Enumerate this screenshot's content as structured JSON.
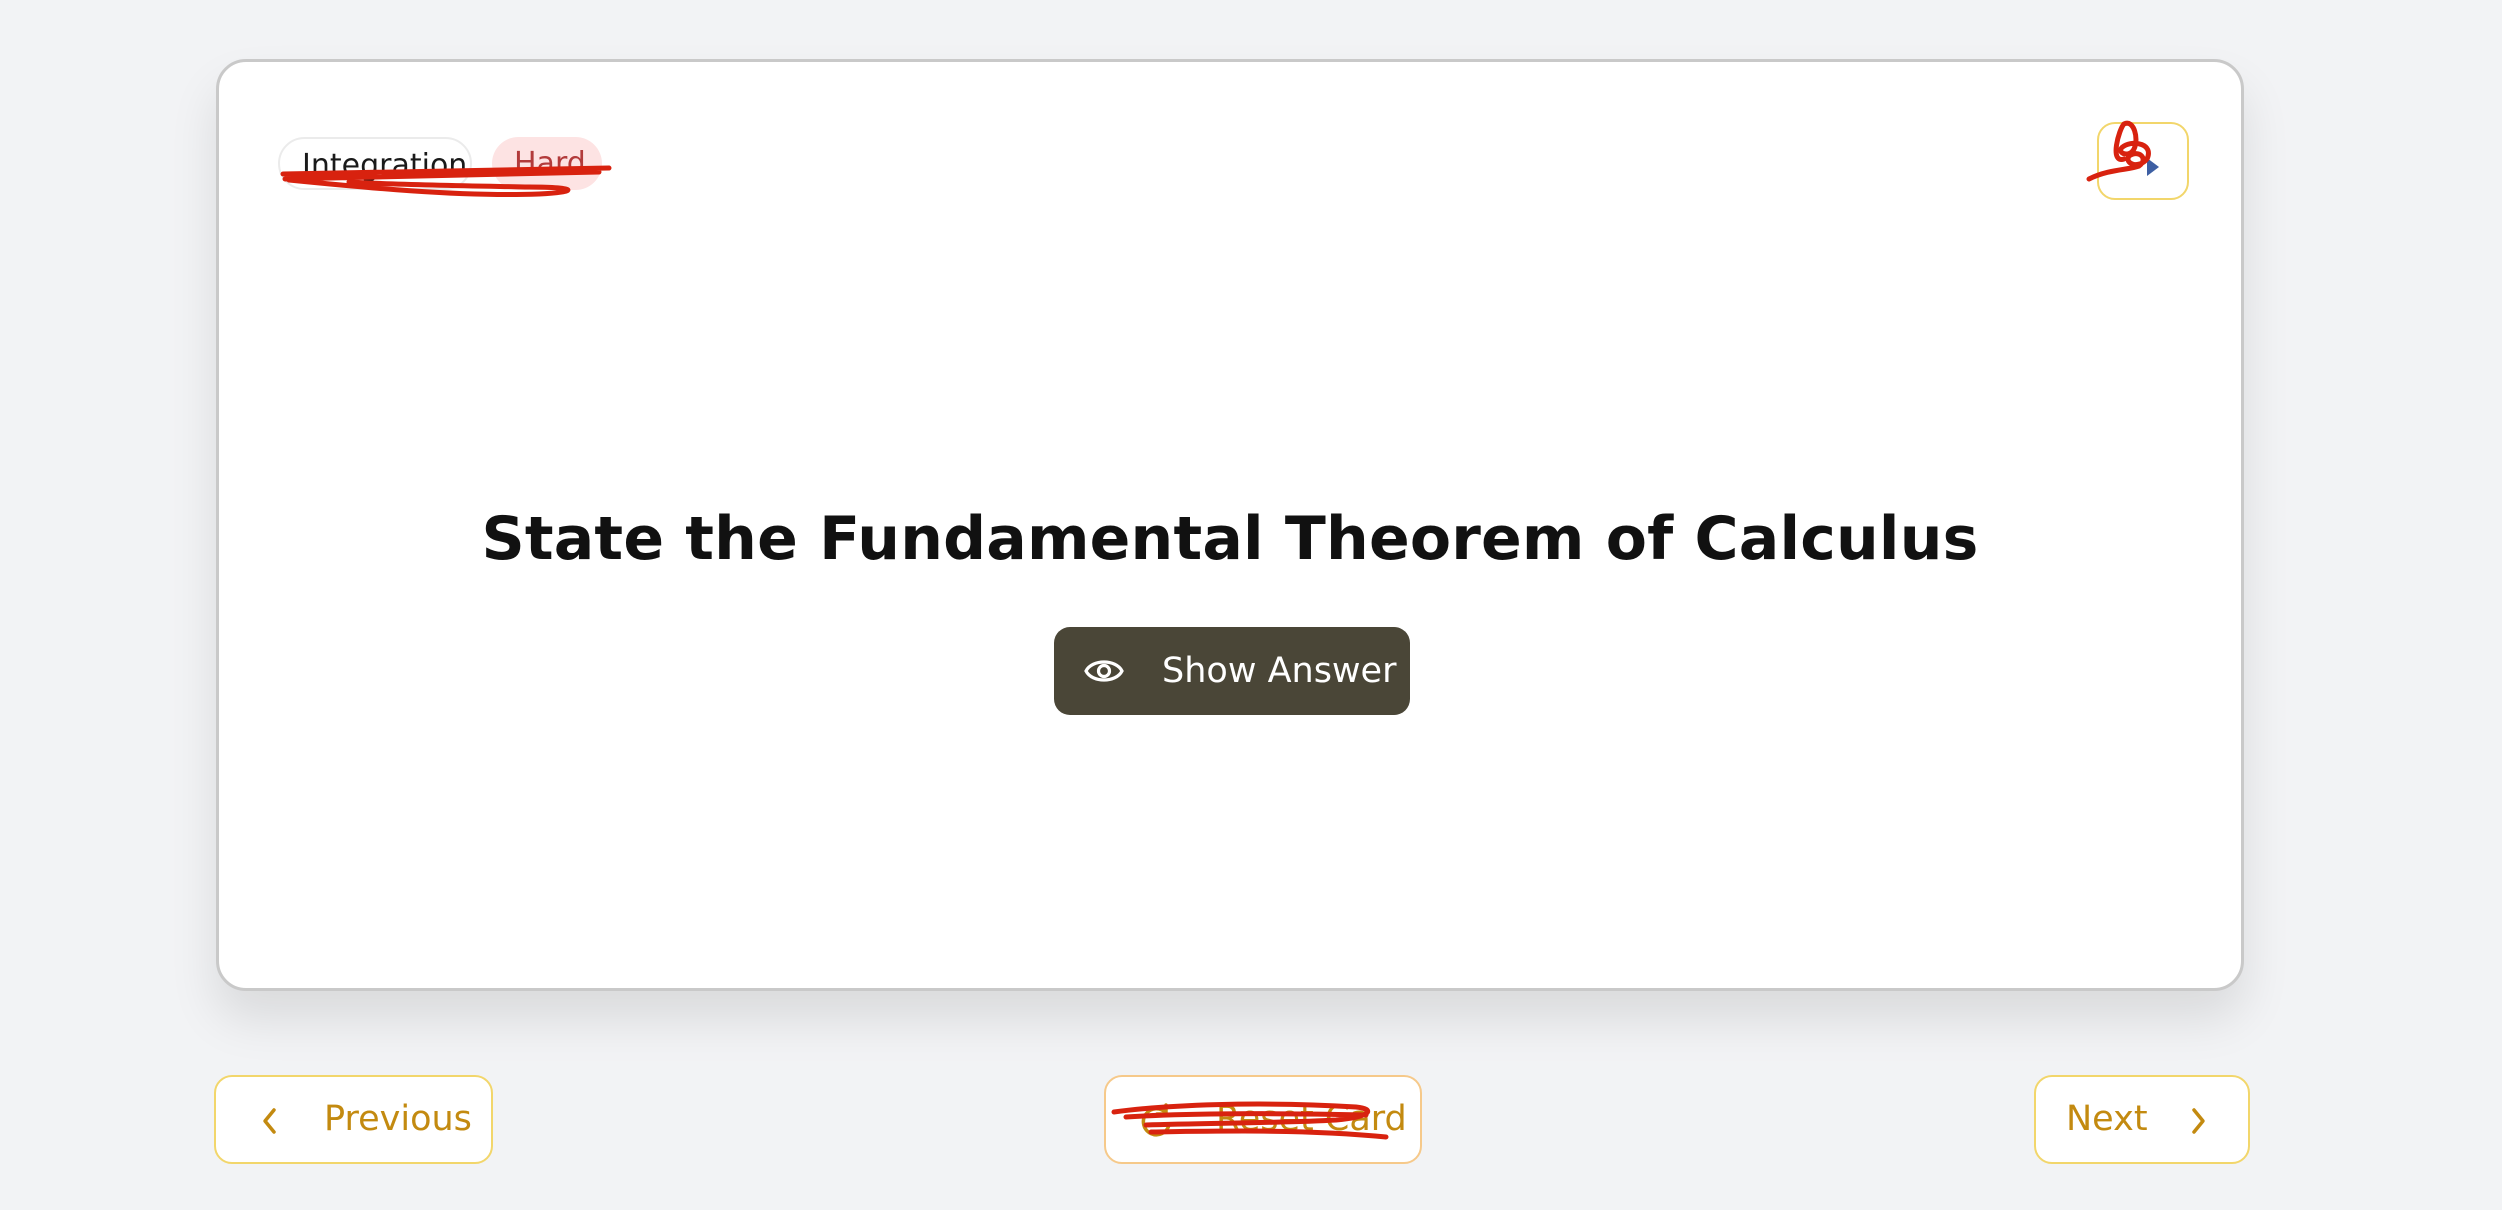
{
  "card": {
    "topic_tag": "Integration",
    "difficulty_tag": "Hard",
    "question": "State the Fundamental Theorem of Calculus",
    "show_answer_label": "Show Answer"
  },
  "icons": {
    "flip": "flip-icon",
    "eye": "eye-icon",
    "previous": "chevron-left-icon",
    "next": "chevron-right-icon",
    "reset": "reset-icon"
  },
  "nav": {
    "previous_label": "Previous",
    "reset_label": "Reset Card",
    "next_label": "Next"
  },
  "colors": {
    "background": "#f2f3f5",
    "card_bg": "#ffffff",
    "primary_button_bg": "#4a4637",
    "accent_text": "#c38a10",
    "accent_border": "#f2d66b",
    "difficulty_bg": "#fde3e3",
    "difficulty_text": "#b23b3b",
    "scribble": "#d8220f"
  }
}
